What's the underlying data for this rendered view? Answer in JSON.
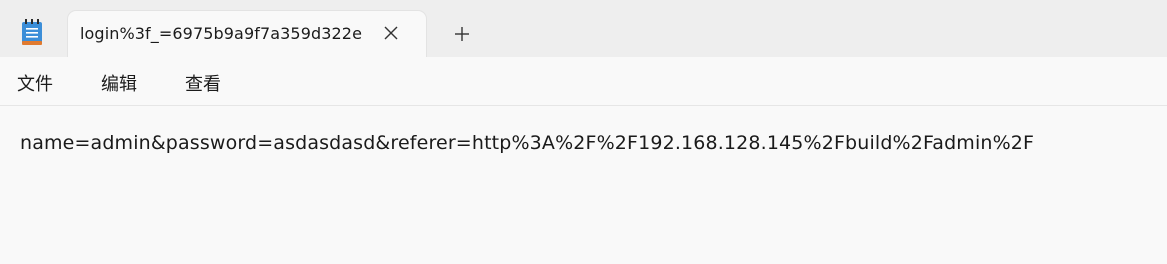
{
  "app": {
    "icon": "notepad-icon"
  },
  "tabs": [
    {
      "title": "login%3f_=6975b9a9f7a359d322e",
      "close_icon": "close-icon"
    }
  ],
  "new_tab_icon": "plus-icon",
  "menu": {
    "file": "文件",
    "edit": "编辑",
    "view": "查看"
  },
  "editor": {
    "content": "name=admin&password=asdasdasd&referer=http%3A%2F%2F192.168.128.145%2Fbuild%2Fadmin%2F"
  },
  "colors": {
    "titlebar_bg": "#eeeeee",
    "window_bg": "#f9f9f9",
    "text": "#1b1b1b",
    "icon_blue": "#3b8ed8",
    "icon_orange": "#e07a2f"
  }
}
